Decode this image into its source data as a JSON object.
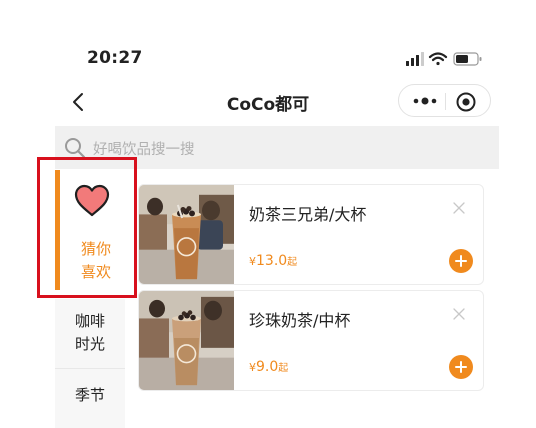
{
  "status_bar": {
    "time": "20:27"
  },
  "nav": {
    "title": "CoCo都可"
  },
  "search": {
    "placeholder": "好喝饮品搜一搜"
  },
  "sidebar": {
    "items": [
      {
        "label_line1": "猜你",
        "label_line2": "喜欢",
        "active": true,
        "icon": "heart-icon"
      },
      {
        "label_line1": "咖啡",
        "label_line2": "时光",
        "active": false
      },
      {
        "label_line1": "季节",
        "active": false
      }
    ]
  },
  "products": [
    {
      "name": "奶茶三兄弟/大杯",
      "currency": "¥",
      "price": "13.0",
      "suffix": "起"
    },
    {
      "name": "珍珠奶茶/中杯",
      "currency": "¥",
      "price": "9.0",
      "suffix": "起"
    }
  ],
  "colors": {
    "accent": "#f08a1e",
    "highlight_box": "#d8101d",
    "search_bg": "#f0f0f0"
  }
}
